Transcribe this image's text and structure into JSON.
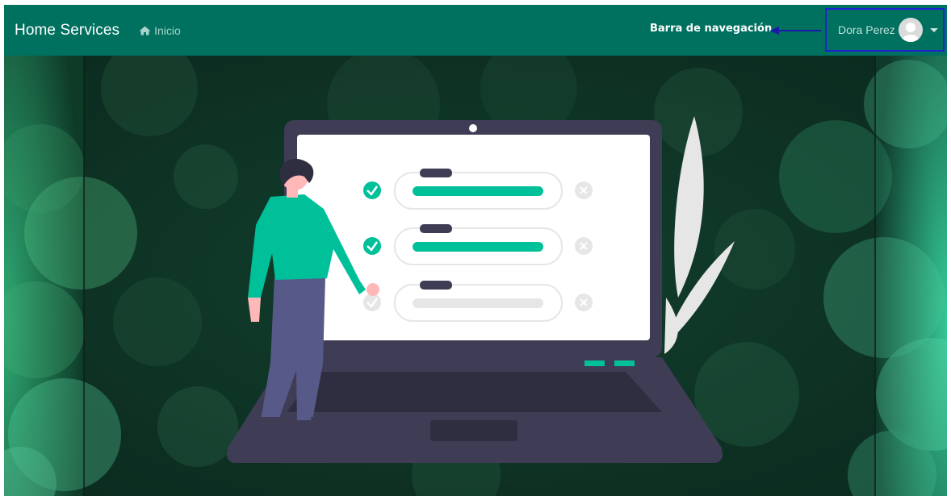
{
  "navbar": {
    "brand": "Home Services",
    "home_link": "Inicio",
    "home_icon": "home-icon",
    "annotation_label": "Barra de navegación",
    "user": {
      "name": "Dora Perez",
      "avatar_icon": "user-avatar-icon",
      "menu_icon": "caret-down-icon"
    }
  },
  "colors": {
    "navbar_bg": "#00705f",
    "accent": "#00c09a",
    "annotation_box": "#1f1fd6",
    "laptop": "#3f3d56"
  },
  "hero": {
    "illustration": "person-checklist-laptop-illustration",
    "checklist": [
      {
        "state": "checked"
      },
      {
        "state": "checked"
      },
      {
        "state": "unchecked"
      }
    ]
  }
}
